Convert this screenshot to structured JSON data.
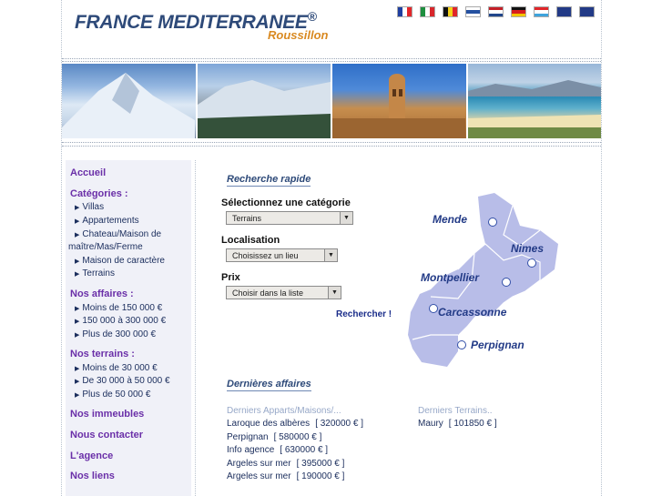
{
  "header": {
    "title": "FRANCE MEDITERRANEE",
    "reg": "®",
    "subtitle": "Roussillon"
  },
  "flags": [
    {
      "name": "fr",
      "stripes": [
        "#1f3fa0",
        "#ffffff",
        "#e3262a"
      ],
      "dir": "v"
    },
    {
      "name": "it",
      "stripes": [
        "#1f8f3f",
        "#ffffff",
        "#d8262b"
      ],
      "dir": "v"
    },
    {
      "name": "be",
      "stripes": [
        "#111111",
        "#f4d21c",
        "#e0262a"
      ],
      "dir": "v"
    },
    {
      "name": "fi",
      "stripes": [
        "#ffffff",
        "#2450a0",
        "#ffffff"
      ],
      "dir": "h"
    },
    {
      "name": "nl",
      "stripes": [
        "#c42028",
        "#ffffff",
        "#21468b"
      ],
      "dir": "h"
    },
    {
      "name": "de",
      "stripes": [
        "#111111",
        "#d81e1e",
        "#f2c500"
      ],
      "dir": "h"
    },
    {
      "name": "lu",
      "stripes": [
        "#e0262a",
        "#ffffff",
        "#3ea3dc"
      ],
      "dir": "h"
    },
    {
      "name": "uk",
      "stripes": [
        "#223a86",
        "#223a86",
        "#223a86"
      ],
      "dir": "h"
    },
    {
      "name": "gb",
      "stripes": [
        "#223a86",
        "#223a86",
        "#223a86"
      ],
      "dir": "h"
    }
  ],
  "nav": {
    "accueil": "Accueil",
    "categories": "Catégories :",
    "cat_items": [
      "Villas",
      "Appartements",
      "Chateau/Maison de",
      "maître/Mas/Ferme",
      "Maison de caractère",
      "Terrains"
    ],
    "affaires": "Nos affaires :",
    "aff_items": [
      "Moins de 150 000 €",
      "150 000 à 300 000 €",
      "Plus de 300 000 €"
    ],
    "terrains": "Nos terrains :",
    "ter_items": [
      "Moins de 30 000 €",
      "De 30 000 à 50 000 €",
      "Plus de 50 000 €"
    ],
    "immeubles": "Nos immeubles",
    "contact": "Nous contacter",
    "agence": "L'agence",
    "liens": "Nos liens"
  },
  "search": {
    "title": "Recherche rapide",
    "cat_label": "Sélectionnez une catégorie",
    "cat_value": "Terrains",
    "loc_label": "Localisation",
    "loc_value": "Choisissez un lieu",
    "prix_label": "Prix",
    "prix_value": "Choisir dans la liste",
    "submit": "Rechercher !"
  },
  "map": {
    "cities": [
      "Mende",
      "Nimes",
      "Montpellier",
      "Carcassonne",
      "Perpignan"
    ],
    "fill": "#b8bde8"
  },
  "latest": {
    "title": "Dernières affaires",
    "col1_head": "Derniers Apparts/Maisons/...",
    "col1": [
      {
        "place": "Laroque des albères",
        "price": "[ 320000 € ]"
      },
      {
        "place": "Perpignan",
        "price": "[ 580000 € ]"
      },
      {
        "place": "Info agence",
        "price": "[ 630000 € ]"
      },
      {
        "place": "Argeles sur mer",
        "price": "[ 395000 € ]"
      },
      {
        "place": "Argeles sur mer",
        "price": "[ 190000 € ]"
      }
    ],
    "col2_head": "Derniers Terrains..",
    "col2": [
      {
        "place": "Maury",
        "price": "[ 101850 € ]"
      }
    ]
  }
}
